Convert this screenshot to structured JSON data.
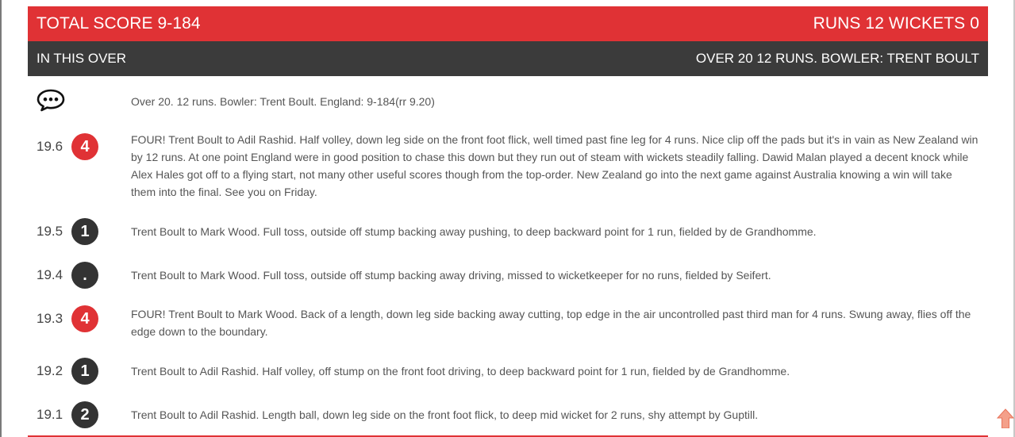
{
  "header": {
    "total_score": "TOTAL SCORE 9-184",
    "runs_wickets": "RUNS 12 WICKETS 0"
  },
  "over_bar": {
    "left_label": "IN THIS OVER",
    "right_label": "OVER 20 12 RUNS. BOWLER: TRENT BOULT"
  },
  "summary": {
    "icon": "speech-bubble-icon",
    "text": "Over 20. 12 runs. Bowler: Trent Boult. England: 9-184(rr 9.20)"
  },
  "balls": [
    {
      "over": "19.6",
      "result": "4",
      "style": "red",
      "text": "FOUR! Trent Boult to Adil Rashid. Half volley, down leg side on the front foot flick, well timed past fine leg for 4 runs. Nice clip off the pads but it's in vain as New Zealand win by 12 runs. At one point England were in good position to chase this down but they run out of steam with wickets steadily falling. Dawid Malan played a decent knock while Alex Hales got off to a flying start, not many other useful scores though from the top-order. New Zealand go into the next game against Australia knowing a win will take them into the final. See you on Friday."
    },
    {
      "over": "19.5",
      "result": "1",
      "style": "dark",
      "text": "Trent Boult to Mark Wood. Full toss, outside off stump backing away pushing, to deep backward point for 1 run, fielded by de Grandhomme."
    },
    {
      "over": "19.4",
      "result": ".",
      "style": "dark",
      "text": "Trent Boult to Mark Wood. Full toss, outside off stump backing away driving, missed to wicketkeeper for no runs, fielded by Seifert."
    },
    {
      "over": "19.3",
      "result": "4",
      "style": "red",
      "text": "FOUR! Trent Boult to Mark Wood. Back of a length, down leg side backing away cutting, top edge in the air uncontrolled past third man for 4 runs. Swung away, flies off the edge down to the boundary."
    },
    {
      "over": "19.2",
      "result": "1",
      "style": "dark",
      "text": "Trent Boult to Adil Rashid. Half volley, off stump on the front foot driving, to deep backward point for 1 run, fielded by de Grandhomme."
    },
    {
      "over": "19.1",
      "result": "2",
      "style": "dark",
      "text": "Trent Boult to Adil Rashid. Length ball, down leg side on the front foot flick, to deep mid wicket for 2 runs, shy attempt by Guptill."
    }
  ],
  "colors": {
    "accent_red": "#e03235",
    "dark_bar": "#3b3b3b",
    "dark_badge": "#333333"
  },
  "scroll_icon": "arrow-up-icon"
}
